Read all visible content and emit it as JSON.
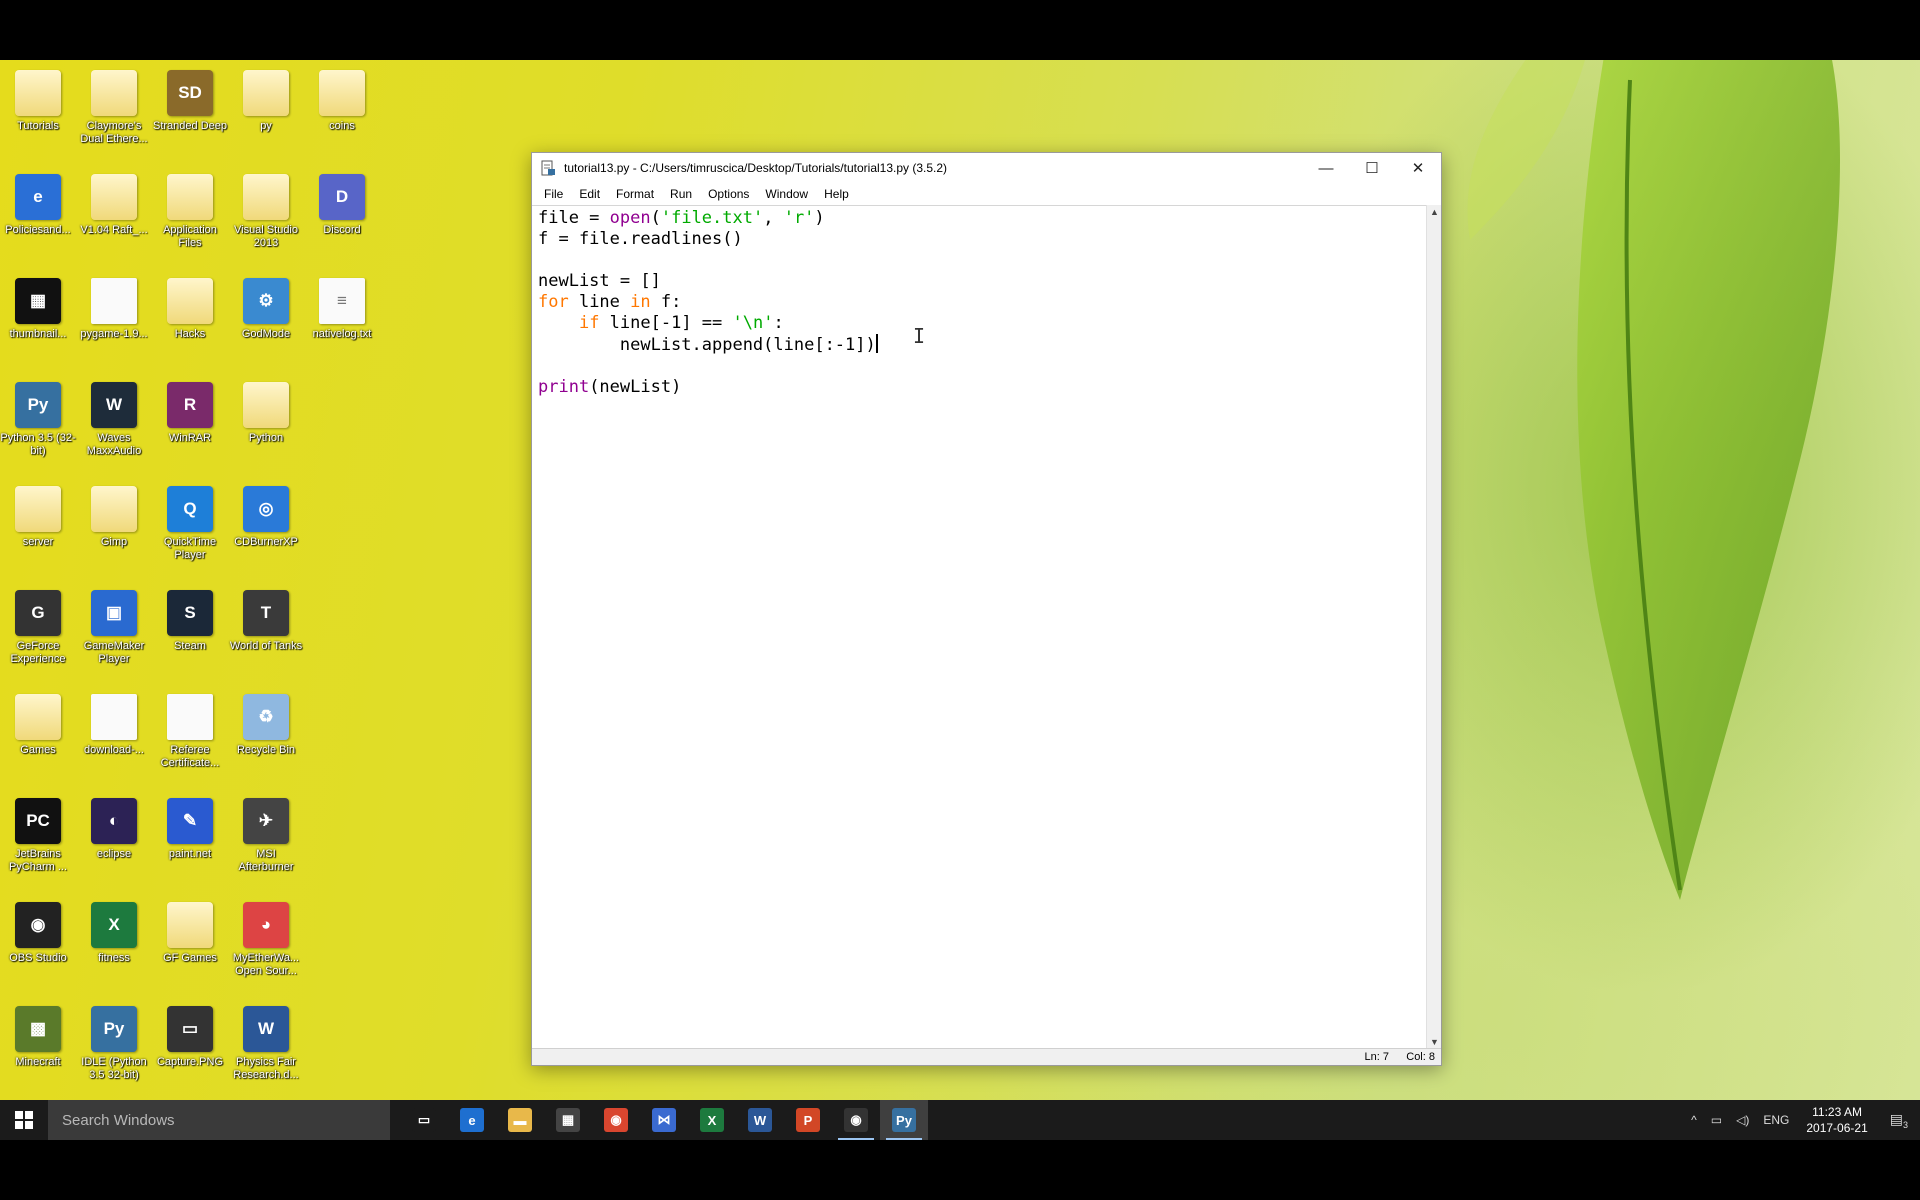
{
  "desktop": {
    "icons": [
      {
        "label": "Tutorials",
        "glyph": "",
        "color": "folder"
      },
      {
        "label": "Claymore's Dual Ethere...",
        "glyph": "",
        "color": "folder"
      },
      {
        "label": "Stranded Deep",
        "glyph": "SD",
        "color": "#8a6a2a"
      },
      {
        "label": "py",
        "glyph": "",
        "color": "folder"
      },
      {
        "label": "coins",
        "glyph": "",
        "color": "folder"
      },
      {
        "label": "Policiesand...",
        "glyph": "e",
        "color": "#2a6fd6"
      },
      {
        "label": "V1.04 Raft_...",
        "glyph": "",
        "color": "folder"
      },
      {
        "label": "Application Files",
        "glyph": "",
        "color": "folder"
      },
      {
        "label": "Visual Studio 2013",
        "glyph": "",
        "color": "folder"
      },
      {
        "label": "Discord",
        "glyph": "D",
        "color": "#5865c8"
      },
      {
        "label": "thumbnail...",
        "glyph": "▦",
        "color": "#111"
      },
      {
        "label": "pygame-1.9...",
        "glyph": "",
        "color": "doc"
      },
      {
        "label": "Hacks",
        "glyph": "",
        "color": "folder"
      },
      {
        "label": "GodMode",
        "glyph": "⚙",
        "color": "#3a8ad0"
      },
      {
        "label": "nativelog.txt",
        "glyph": "≡",
        "color": "doc"
      },
      {
        "label": "Python 3.5 (32-bit)",
        "glyph": "Py",
        "color": "#3670a0"
      },
      {
        "label": "Waves MaxxAudio",
        "glyph": "W",
        "color": "#1e2c3a"
      },
      {
        "label": "WinRAR",
        "glyph": "R",
        "color": "#7a2a6a"
      },
      {
        "label": "Python",
        "glyph": "",
        "color": "folder"
      },
      {
        "label": "server",
        "glyph": "",
        "color": "folder"
      },
      {
        "label": "Gimp",
        "glyph": "",
        "color": "folder"
      },
      {
        "label": "QuickTime Player",
        "glyph": "Q",
        "color": "#1e7fd8"
      },
      {
        "label": "CDBurnerXP",
        "glyph": "◎",
        "color": "#2a7ad8"
      },
      {
        "label": "GeForce Experience",
        "glyph": "G",
        "color": "#333"
      },
      {
        "label": "GameMaker Player",
        "glyph": "▣",
        "color": "#2a6ad0"
      },
      {
        "label": "Steam",
        "glyph": "S",
        "color": "#1b2838"
      },
      {
        "label": "World of Tanks",
        "glyph": "T",
        "color": "#3a3a3a"
      },
      {
        "label": "Games",
        "glyph": "",
        "color": "folder"
      },
      {
        "label": "download-...",
        "glyph": "",
        "color": "doc"
      },
      {
        "label": "Referee Certificate...",
        "glyph": "",
        "color": "doc"
      },
      {
        "label": "Recycle Bin",
        "glyph": "♻",
        "color": "#8fb8e0"
      },
      {
        "label": "JetBrains PyCharm ...",
        "glyph": "PC",
        "color": "#111"
      },
      {
        "label": "eclipse",
        "glyph": "◐",
        "color": "#2c2255"
      },
      {
        "label": "paint.net",
        "glyph": "✎",
        "color": "#2a5ad0"
      },
      {
        "label": "MSI Afterburner",
        "glyph": "✈",
        "color": "#444"
      },
      {
        "label": "OBS Studio",
        "glyph": "◉",
        "color": "#222"
      },
      {
        "label": "fitness",
        "glyph": "X",
        "color": "#1d7a3e"
      },
      {
        "label": "GF Games",
        "glyph": "",
        "color": "folder"
      },
      {
        "label": "MyEtherWa... Open Sour...",
        "glyph": "◕",
        "color": "#d44"
      },
      {
        "label": "Minecraft",
        "glyph": "▩",
        "color": "#5a7a2a"
      },
      {
        "label": "IDLE (Python 3.5 32-bit)",
        "glyph": "Py",
        "color": "#3670a0"
      },
      {
        "label": "Capture.PNG",
        "glyph": "▭",
        "color": "#333"
      },
      {
        "label": "Physics Fair Research.d...",
        "glyph": "W",
        "color": "#2b5797"
      }
    ]
  },
  "window": {
    "title": "tutorial13.py - C:/Users/timruscica/Desktop/Tutorials/tutorial13.py (3.5.2)",
    "menu": [
      "File",
      "Edit",
      "Format",
      "Run",
      "Options",
      "Window",
      "Help"
    ],
    "buttons": {
      "minimize": "—",
      "maximize": "☐",
      "close": "✕"
    },
    "status": {
      "line": "Ln: 7",
      "col": "Col: 8"
    }
  },
  "code": {
    "l1_var": "file = ",
    "l1_fn": "open",
    "l1_a": "(",
    "l1_s1": "'file.txt'",
    "l1_b": ", ",
    "l1_s2": "'r'",
    "l1_c": ")",
    "l2": "f = file.readlines()",
    "l4": "newList = []",
    "l5_for": "for",
    "l5_a": " line ",
    "l5_in": "in",
    "l5_b": " f:",
    "l6_indent": "    ",
    "l6_if": "if",
    "l6_a": " line[-1] == ",
    "l6_s": "'\\n'",
    "l6_b": ":",
    "l7": "        newList.append(line[:-1])",
    "l9_fn": "print",
    "l9_a": "(newList)"
  },
  "taskbar": {
    "search_placeholder": "Search Windows",
    "apps": [
      {
        "name": "task-view-icon",
        "glyph": "▭",
        "color": "#1b1b1b"
      },
      {
        "name": "edge-icon",
        "glyph": "e",
        "color": "#1e6fd0"
      },
      {
        "name": "file-explorer-icon",
        "glyph": "▬",
        "color": "#e8b84a"
      },
      {
        "name": "store-icon",
        "glyph": "▦",
        "color": "#444"
      },
      {
        "name": "chrome-icon",
        "glyph": "◉",
        "color": "#d9462f"
      },
      {
        "name": "visual-studio-icon",
        "glyph": "⋈",
        "color": "#3a6ad0"
      },
      {
        "name": "excel-icon",
        "glyph": "X",
        "color": "#1d7a3e"
      },
      {
        "name": "word-icon",
        "glyph": "W",
        "color": "#2b5797"
      },
      {
        "name": "powerpoint-icon",
        "glyph": "P",
        "color": "#d24726"
      },
      {
        "name": "obs-icon",
        "glyph": "◉",
        "color": "#333"
      },
      {
        "name": "idle-icon",
        "glyph": "Py",
        "color": "#3670a0"
      }
    ],
    "tray": {
      "lang": "ENG",
      "time": "11:23 AM",
      "date": "2017-06-21",
      "notification_count": "3"
    }
  }
}
